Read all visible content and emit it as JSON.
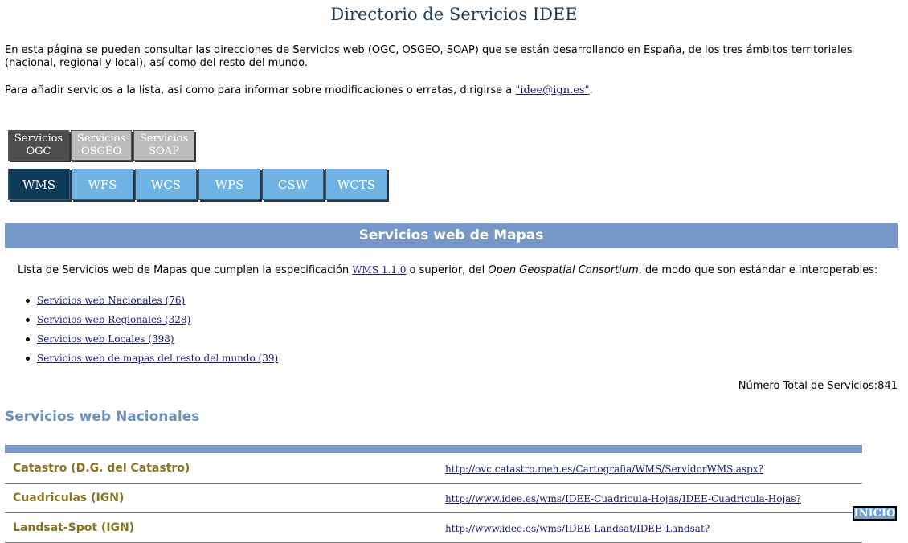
{
  "page": {
    "title": "Directorio de Servicios IDEE",
    "intro": "En esta página se pueden consultar las direcciones de Servicios web (OGC, OSGEO, SOAP) que se están desarrollando en España, de los tres ámbitos territoriales (nacional, regional y local), así como del resto del mundo.",
    "contact_prefix": "Para añadir servicios a la lista, asi como para informar sobre modificaciones o erratas, dirigirse a ",
    "contact_link": "\"idee@ign.es\"",
    "contact_suffix": "."
  },
  "service_tabs": [
    {
      "line1": "Servicios",
      "line2": "OGC",
      "active": true
    },
    {
      "line1": "Servicios",
      "line2": "OSGEO",
      "active": false
    },
    {
      "line1": "Servicios",
      "line2": "SOAP",
      "active": false
    }
  ],
  "standard_tabs": [
    {
      "label": "WMS",
      "active": true
    },
    {
      "label": "WFS",
      "active": false
    },
    {
      "label": "WCS",
      "active": false
    },
    {
      "label": "WPS",
      "active": false
    },
    {
      "label": "CSW",
      "active": false
    },
    {
      "label": "WCTS",
      "active": false
    }
  ],
  "banner": "Servicios web de Mapas",
  "description": {
    "prefix": "Lista de Servicios web de Mapas que cumplen la especificación ",
    "spec_link": "WMS 1.1.0",
    "middle": " o superior, del ",
    "org": "Open Geospatial Consortium",
    "suffix": ", de modo que son estándar e interoperables:"
  },
  "service_links": [
    "Servicios web Nacionales (76)",
    "Servicios web Regionales (328)",
    "Servicios web Locales (398)",
    "Servicios web de mapas del resto del mundo (39)"
  ],
  "total": "Número Total de Servicios:841",
  "section_heading": "Servicios web Nacionales",
  "rows": [
    {
      "name": "Catastro (D.G. del Catastro)",
      "url": "http://ovc.catastro.meh.es/Cartografia/WMS/ServidorWMS.aspx?"
    },
    {
      "name": "Cuadriculas (IGN)",
      "url": "http://www.idee.es/wms/IDEE-Cuadricula-Hojas/IDEE-Cuadricula-Hojas?"
    },
    {
      "name": "Landsat-Spot (IGN)",
      "url": "http://www.idee.es/wms/IDEE-Landsat/IDEE-Landsat?"
    }
  ],
  "inicio_label": "INICIO",
  "colors": {
    "banner": "#7797c9",
    "tab_active": "#0e3a57",
    "tab_inactive": "#6fb3e4",
    "row_name": "#8a7420",
    "section_heading": "#6c91ba"
  }
}
